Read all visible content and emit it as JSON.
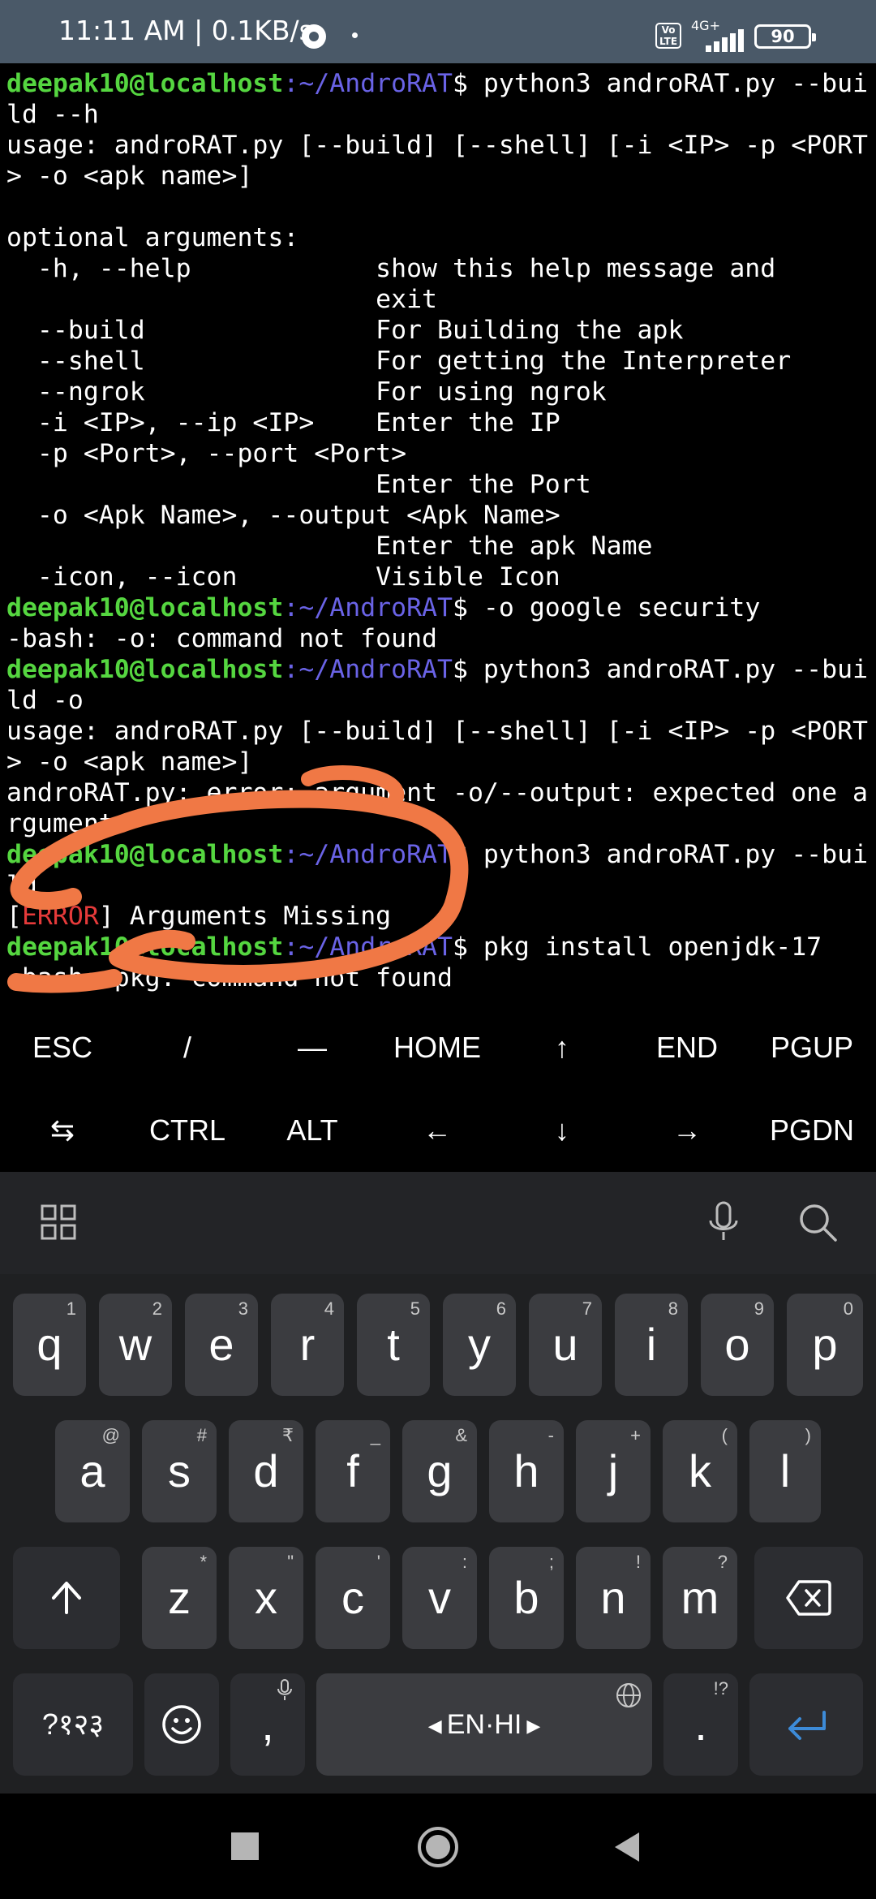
{
  "status_bar": {
    "time": "11:11 AM | 0.1KB/s",
    "volte": "Vo LTE",
    "network": "4G+",
    "battery": "90"
  },
  "terminal": {
    "user": "deepak10@localhost",
    "path": ":~/AndroRAT",
    "lines": [
      "$ python3 androRAT.py --bui",
      "ld --h",
      "usage: androRAT.py [--build] [--shell] [-i <IP> -p <PORT",
      "> -o <apk name>]",
      "",
      "optional arguments:",
      "  -h, --help            show this help message and",
      "                        exit",
      "  --build               For Building the apk",
      "  --shell               For getting the Interpreter",
      "  --ngrok               For using ngrok",
      "  -i <IP>, --ip <IP>    Enter the IP",
      "  -p <Port>, --port <Port>",
      "                        Enter the Port",
      "  -o <Apk Name>, --output <Apk Name>",
      "                        Enter the apk Name",
      "  -icon, --icon         Visible Icon",
      "$ -o google security",
      "-bash: -o: command not found",
      "$ python3 androRAT.py --bui",
      "ld -o",
      "usage: androRAT.py [--build] [--shell] [-i <IP> -p <PORT",
      "> -o <apk name>]",
      "androRAT.py: error: argument -o/--output: expected one a",
      "rgument",
      "$ python3 androRAT.py --bui",
      "ld",
      "] Arguments Missing",
      "$ pkg install openjdk-17",
      "-bash: pkg: command not found"
    ],
    "error_tag": "ERROR",
    "bracket_open": "["
  },
  "extra_keys": {
    "row1": [
      "ESC",
      "/",
      "—",
      "HOME",
      "↑",
      "END",
      "PGUP"
    ],
    "row2": [
      "⇆",
      "CTRL",
      "ALT",
      "←",
      "↓",
      "→",
      "PGDN"
    ]
  },
  "keyboard": {
    "row1": [
      {
        "k": "q",
        "s": "1"
      },
      {
        "k": "w",
        "s": "2"
      },
      {
        "k": "e",
        "s": "3"
      },
      {
        "k": "r",
        "s": "4"
      },
      {
        "k": "t",
        "s": "5"
      },
      {
        "k": "y",
        "s": "6"
      },
      {
        "k": "u",
        "s": "7"
      },
      {
        "k": "i",
        "s": "8"
      },
      {
        "k": "o",
        "s": "9"
      },
      {
        "k": "p",
        "s": "0"
      }
    ],
    "row2": [
      {
        "k": "a",
        "s": "@"
      },
      {
        "k": "s",
        "s": "#"
      },
      {
        "k": "d",
        "s": "₹"
      },
      {
        "k": "f",
        "s": "_"
      },
      {
        "k": "g",
        "s": "&"
      },
      {
        "k": "h",
        "s": "-"
      },
      {
        "k": "j",
        "s": "+"
      },
      {
        "k": "k",
        "s": "("
      },
      {
        "k": "l",
        "s": ")"
      }
    ],
    "row3": [
      {
        "k": "z",
        "s": "*"
      },
      {
        "k": "x",
        "s": "\""
      },
      {
        "k": "c",
        "s": "'"
      },
      {
        "k": "v",
        "s": ":"
      },
      {
        "k": "b",
        "s": ";"
      },
      {
        "k": "n",
        "s": "!"
      },
      {
        "k": "m",
        "s": "?"
      }
    ],
    "symbols_key": "?१२३",
    "comma_key": ",",
    "space_label": "EN·HI",
    "period_key": ".",
    "period_sub": "!?",
    "icons": [
      "apps-grid-icon",
      "microphone-icon",
      "search-icon",
      "shift-icon",
      "backspace-icon",
      "emoji-icon",
      "globe-icon",
      "enter-icon"
    ]
  },
  "colors": {
    "user": "#55d640",
    "path": "#6a63e6",
    "error": "#e53a3a",
    "annotation": "#f07845",
    "enter": "#3d8bd8"
  }
}
